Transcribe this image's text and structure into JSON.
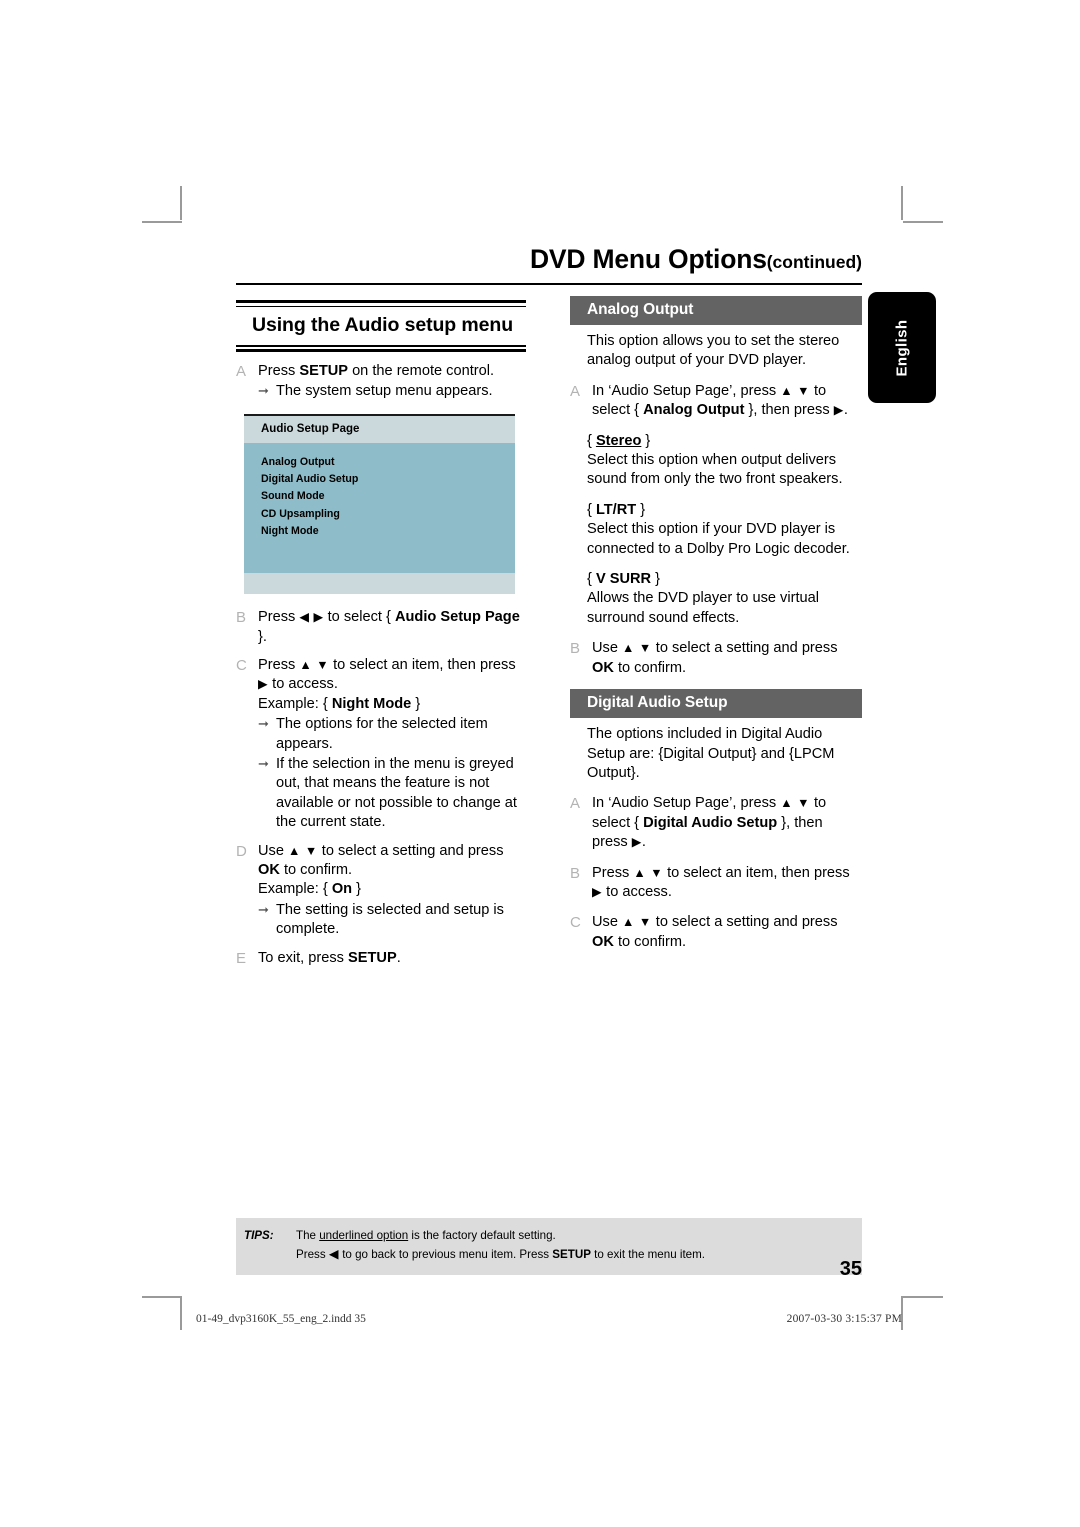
{
  "running_head": {
    "title": "DVD Menu Options",
    "continued": "(continued)"
  },
  "language_tab": {
    "label": "English"
  },
  "left_column": {
    "section_heading": "Using the Audio setup menu",
    "steps": [
      {
        "marker": "A",
        "text_before_bold": "Press ",
        "bold": "SETUP",
        "text_after_bold": " on the remote control.",
        "arrows": [
          "The system setup menu appears."
        ]
      },
      {
        "marker": "B",
        "line1_pre": "Press ",
        "arrows_glyph": "◀ ▶",
        "line1_mid": " to select { ",
        "bold1": "Audio Setup",
        "bold2": "Page",
        "line1_post": " }."
      },
      {
        "marker": "C",
        "line1_pre": "Press ",
        "updown": "▲ ▼",
        "line1_mid": " to select an item, then press",
        "line2_glyph": "▶",
        "line2_text": " to access.",
        "example_label": "Example: { ",
        "example_bold": "Night Mode",
        "example_close": " }",
        "arrows": [
          "The options for the selected item appears.",
          "If the selection in the menu is greyed out, that means the feature is not available or not possible to change at the current state."
        ]
      },
      {
        "marker": "D",
        "line1_pre": "Use ",
        "updown": "▲ ▼",
        "line1_mid": " to select a setting and press",
        "ok": "OK",
        "line2_post": " to confirm.",
        "example_label": "Example: { ",
        "example_bold": "On",
        "example_close": " }",
        "arrows": [
          "The setting is selected and setup is complete."
        ]
      },
      {
        "marker": "E",
        "text_before_bold": "To exit, press ",
        "bold": "SETUP",
        "text_after_bold": "."
      }
    ],
    "osd": {
      "title": "Audio Setup Page",
      "items": [
        "Analog Output",
        "Digital Audio Setup",
        "Sound Mode",
        "CD Upsampling",
        "Night Mode"
      ]
    }
  },
  "right_column": {
    "sections": [
      {
        "heading": "Analog Output",
        "intro": "This option allows you to set the stereo analog output of your DVD player.",
        "step_a": {
          "marker": "A",
          "pre": "In ‘Audio Setup Page’, press ",
          "updown": "▲ ▼",
          "mid": " to select { ",
          "bold": "Analog Output",
          "post": " }, then press ",
          "right_arrow": "▶",
          "end": "."
        },
        "options": [
          {
            "open": "{ ",
            "name": "Stereo",
            "underlined": true,
            "close": " }",
            "desc": "Select this option when output delivers sound from only the two front speakers."
          },
          {
            "open": "{ ",
            "name": "LT/RT",
            "underlined": false,
            "close": " }",
            "desc": "Select this option if your DVD player is connected to a Dolby Pro Logic decoder."
          },
          {
            "open": "{ ",
            "name": "V SURR",
            "underlined": false,
            "close": " }",
            "desc": "Allows the DVD player to use virtual surround sound effects."
          }
        ],
        "step_b": {
          "marker": "B",
          "pre": "Use ",
          "updown": "▲ ▼",
          "mid": " to select a setting and press",
          "ok": "OK",
          "post": " to confirm."
        }
      },
      {
        "heading": "Digital Audio Setup",
        "intro": "The options included in Digital Audio Setup are: {Digital Output} and {LPCM Output}.",
        "step_a": {
          "marker": "A",
          "pre": "In ‘Audio Setup Page’, press ",
          "updown": "▲ ▼",
          "mid": " to select { ",
          "bold": "Digital Audio Setup",
          "post": " }, then press ",
          "right_arrow": "▶",
          "end": "."
        },
        "step_b": {
          "marker": "B",
          "pre": "Press ",
          "updown": "▲ ▼",
          "mid": " to select an item, then press",
          "line2_glyph": "▶",
          "line2_text": " to access."
        },
        "step_c": {
          "marker": "C",
          "pre": "Use ",
          "updown": "▲ ▼",
          "mid": " to select a setting and press",
          "ok": "OK",
          "post": " to confirm."
        }
      }
    ]
  },
  "tips": {
    "label": "TIPS:",
    "line1_pre": "The ",
    "line1_underlined": "underlined option",
    "line1_post": " is the factory default setting.",
    "line2_pre": "Press ",
    "line2_glyph": "◀",
    "line2_mid": " to go back to previous menu item. Press ",
    "line2_bold": "SETUP",
    "line2_post": " to exit the menu item."
  },
  "page_number": "35",
  "print_footer": {
    "file": "01-49_dvp3160K_55_eng_2.indd   35",
    "timestamp": "2007-03-30   3:15:37 PM"
  },
  "colors": {
    "osd_header": "#cbd9dc",
    "osd_body": "#8ebcc8",
    "section_header": "#636363",
    "tips_background": "#dcdcdc",
    "marker_gray": "#b3b3b3"
  }
}
